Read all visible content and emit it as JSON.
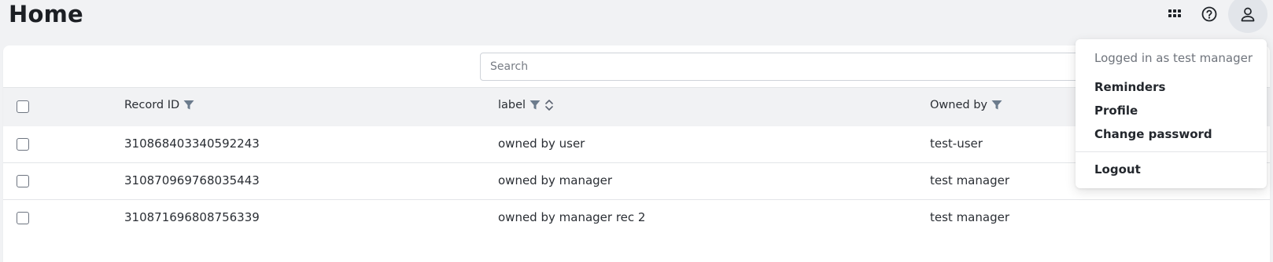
{
  "header": {
    "title": "Home",
    "icons": [
      "apps-grid-icon",
      "help-circle-icon",
      "user-icon"
    ]
  },
  "search": {
    "placeholder": "Search",
    "value": ""
  },
  "table": {
    "columns": [
      {
        "label": "Record ID",
        "filter": true,
        "sort": false
      },
      {
        "label": "label",
        "filter": true,
        "sort": true
      },
      {
        "label": "Owned by",
        "filter": true,
        "sort": false
      }
    ],
    "rows": [
      {
        "record_id": "310868403340592243",
        "label": "owned by user",
        "owned_by": "test-user"
      },
      {
        "record_id": "310870969768035443",
        "label": "owned by manager",
        "owned_by": "test manager"
      },
      {
        "record_id": "310871696808756339",
        "label": "owned by manager rec 2",
        "owned_by": "test manager"
      }
    ]
  },
  "user_menu": {
    "header": "Logged in as test manager",
    "items": [
      "Reminders",
      "Profile",
      "Change password"
    ],
    "logout": "Logout"
  },
  "colors": {
    "page_bg": "#f1f2f4",
    "filter_icon": "#6b7b8c"
  }
}
